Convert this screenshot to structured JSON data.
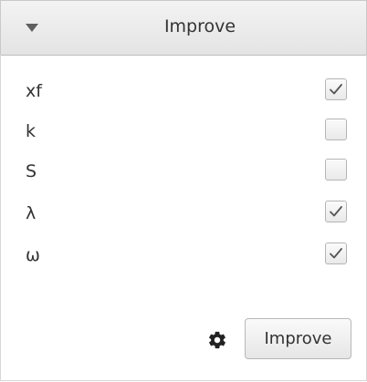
{
  "header": {
    "title": "Improve",
    "arrow_icon": "chevron-down-icon"
  },
  "options": [
    {
      "label": "xf",
      "checked": true
    },
    {
      "label": "k",
      "checked": false
    },
    {
      "label": "S",
      "checked": false
    },
    {
      "label": "λ",
      "checked": true
    },
    {
      "label": "ω",
      "checked": true
    }
  ],
  "footer": {
    "settings_icon": "gear-icon",
    "button_label": "Improve"
  },
  "colors": {
    "text": "#333333",
    "header_bg": "#e9e9e9",
    "border": "#c9c9c9",
    "check": "#555555"
  }
}
